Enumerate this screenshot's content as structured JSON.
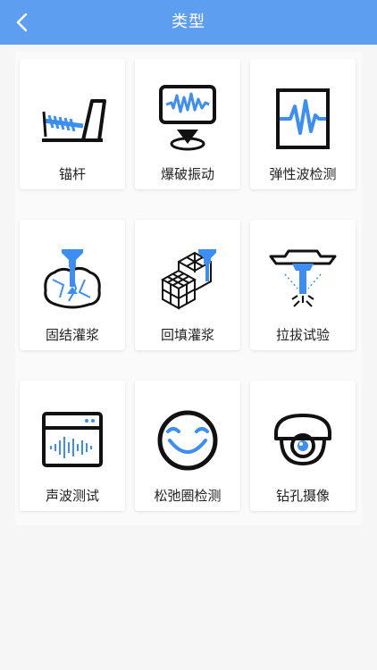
{
  "header": {
    "title": "类型",
    "back_icon": "chevron-left-icon",
    "color": "#5d9ef1"
  },
  "accent": "#3c8ef5",
  "grid": {
    "items": [
      {
        "label": "锚杆",
        "icon": "anchor-rod-icon"
      },
      {
        "label": "爆破振动",
        "icon": "blast-vibration-icon"
      },
      {
        "label": "弹性波检测",
        "icon": "elastic-wave-icon"
      },
      {
        "label": "固结灌浆",
        "icon": "consolidation-grouting-icon"
      },
      {
        "label": "回填灌浆",
        "icon": "backfill-grouting-icon"
      },
      {
        "label": "拉拔试验",
        "icon": "pull-out-test-icon"
      },
      {
        "label": "声波测试",
        "icon": "sonic-wave-test-icon"
      },
      {
        "label": "松弛圈检测",
        "icon": "relaxation-circle-icon"
      },
      {
        "label": "钻孔摄像",
        "icon": "borehole-camera-icon"
      }
    ]
  }
}
